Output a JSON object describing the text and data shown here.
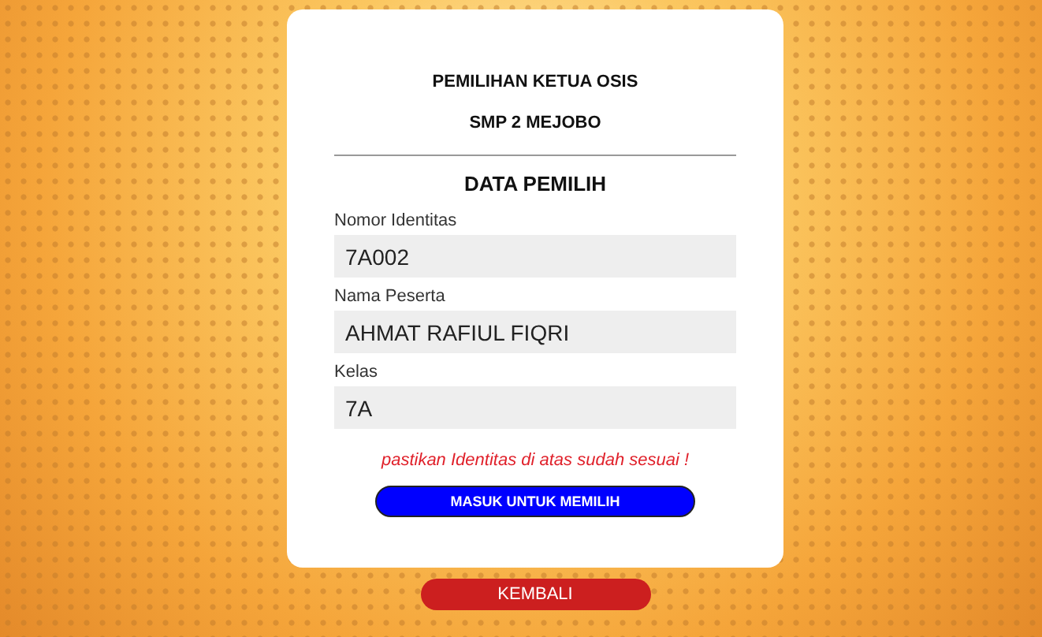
{
  "header": {
    "title": "PEMILIHAN KETUA OSIS",
    "subtitle": "SMP 2 MEJOBO"
  },
  "section_title": "DATA PEMILIH",
  "fields": [
    {
      "label": "Nomor Identitas",
      "value": "7A002"
    },
    {
      "label": "Nama Peserta",
      "value": "AHMAT RAFIUL FIQRI"
    },
    {
      "label": "Kelas",
      "value": "7A"
    }
  ],
  "warning": "pastikan Identitas di atas sudah sesuai !",
  "submit_button": "MASUK UNTUK MEMILIH",
  "back_button": "KEMBALI"
}
